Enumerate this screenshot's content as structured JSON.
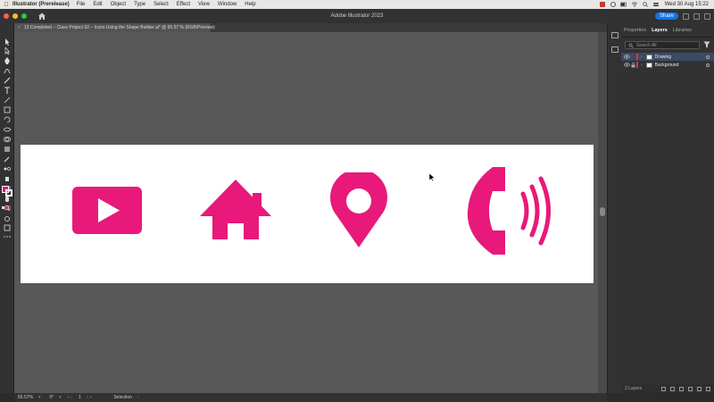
{
  "menubar": {
    "apple_icon": "apple-icon",
    "app_name": "Illustrator (Prerelease)",
    "items": [
      "File",
      "Edit",
      "Object",
      "Type",
      "Select",
      "Effect",
      "View",
      "Window",
      "Help"
    ],
    "clock": "Wed 30 Aug  15:22"
  },
  "appbar": {
    "title": "Adobe Illustrator 2023",
    "share_label": "Share"
  },
  "document": {
    "tab_label": "13 Completed – Class Project 02 – Icons Using the Shape Builder.ai* @ 65.57 % (RGB/Preview)"
  },
  "layers_panel": {
    "tabs": [
      "Properties",
      "Layers",
      "Libraries"
    ],
    "active_tab": "Layers",
    "search_placeholder": "Search All",
    "layers": [
      {
        "name": "Drawing",
        "color": "#e8353b",
        "selected": true
      },
      {
        "name": "Background",
        "color": "#e8353b",
        "selected": false
      }
    ],
    "footer_count": "2 Layers"
  },
  "statusbar": {
    "zoom": "65.57%",
    "rotation": "0°",
    "artboard": "1",
    "tool": "Selection"
  },
  "colors": {
    "accent_pink": "#e8197a",
    "share_blue": "#1473e6",
    "artboard": "#ffffff",
    "canvas": "#585858"
  },
  "artwork_icons": [
    "video-play-icon",
    "house-icon",
    "location-pin-icon",
    "phone-call-icon"
  ]
}
